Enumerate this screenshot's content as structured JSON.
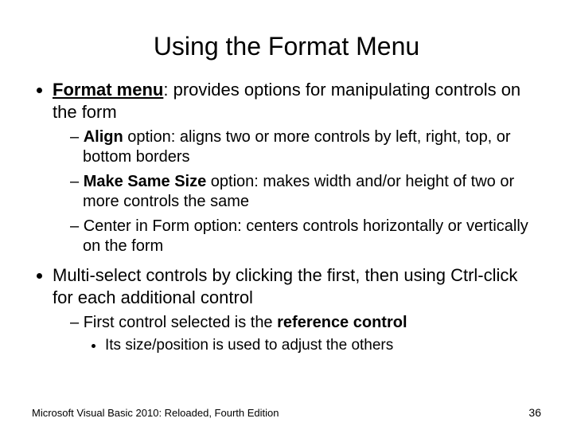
{
  "title": "Using the Format Menu",
  "bullets": {
    "b1": {
      "bold_under": "Format menu",
      "rest": ": provides options for manipulating controls on the form",
      "subs": {
        "s1": {
          "bold": "Align",
          "rest": " option: aligns two or more controls by left, right, top, or bottom borders"
        },
        "s2": {
          "bold": "Make Same Size",
          "rest": " option: makes width and/or height of two or more controls the same"
        },
        "s3": {
          "full": "Center in Form option: centers controls horizontally or vertically on the form"
        }
      }
    },
    "b2": {
      "full": "Multi-select controls by clicking the first, then using Ctrl-click for each additional control",
      "subs": {
        "s1": {
          "pre": "First control selected is the ",
          "bold": "reference control",
          "subsub": {
            "t1": "Its size/position is used to adjust the others"
          }
        }
      }
    }
  },
  "footer": "Microsoft Visual Basic 2010: Reloaded, Fourth Edition",
  "page": "36"
}
